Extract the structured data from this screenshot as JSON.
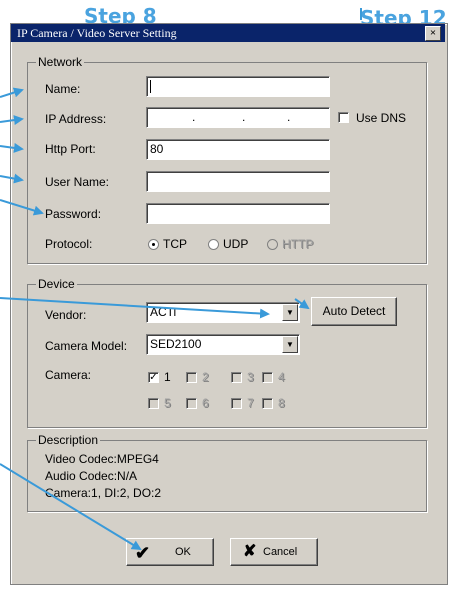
{
  "annotations": {
    "step_left": "Step 8",
    "step_right": "Step 12"
  },
  "window": {
    "title": "IP Camera / Video Server Setting",
    "close_label": "×"
  },
  "network": {
    "group_label": "Network",
    "name_label": "Name:",
    "name_value": "",
    "ip_label": "IP Address:",
    "ip_dots": [
      ".",
      ".",
      "."
    ],
    "use_dns_label": "Use DNS",
    "use_dns_checked": false,
    "http_label": "Http Port:",
    "http_value": "80",
    "user_label": "User Name:",
    "user_value": "",
    "password_label": "Password:",
    "password_value": "",
    "protocol_label": "Protocol:",
    "protocols": [
      {
        "label": "TCP",
        "selected": true,
        "enabled": true
      },
      {
        "label": "UDP",
        "selected": false,
        "enabled": true
      },
      {
        "label": "HTTP",
        "selected": false,
        "enabled": false
      }
    ]
  },
  "device": {
    "group_label": "Device",
    "vendor_label": "Vendor:",
    "vendor_value": "ACTi",
    "auto_detect_label": "Auto Detect",
    "model_label": "Camera Model:",
    "model_value": "SED2100",
    "camera_label": "Camera:",
    "cameras": [
      {
        "label": "1",
        "checked": true,
        "enabled": true
      },
      {
        "label": "2",
        "checked": false,
        "enabled": false
      },
      {
        "label": "3",
        "checked": false,
        "enabled": false
      },
      {
        "label": "4",
        "checked": false,
        "enabled": false
      },
      {
        "label": "5",
        "checked": false,
        "enabled": false
      },
      {
        "label": "6",
        "checked": false,
        "enabled": false
      },
      {
        "label": "7",
        "checked": false,
        "enabled": false
      },
      {
        "label": "8",
        "checked": false,
        "enabled": false
      }
    ]
  },
  "description": {
    "group_label": "Description",
    "line1": "Video Codec:MPEG4",
    "line2": "Audio Codec:N/A",
    "line3": "Camera:1, DI:2, DO:2"
  },
  "buttons": {
    "ok_label": "OK",
    "cancel_label": "Cancel"
  },
  "icons": {
    "ok": "checkmark-icon",
    "cancel": "x-icon",
    "arrow_color": "#3a9ad9"
  }
}
